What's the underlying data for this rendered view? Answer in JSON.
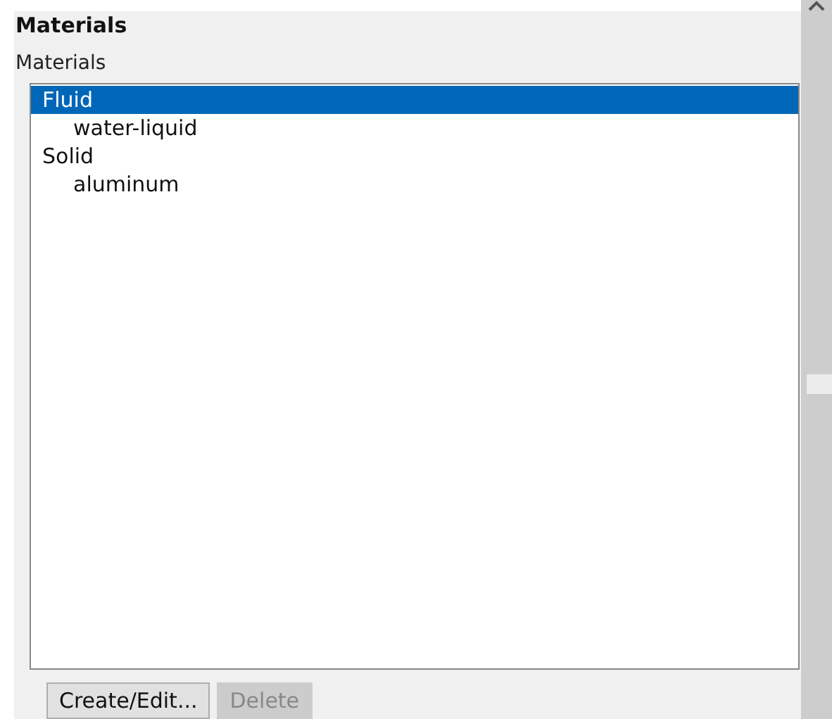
{
  "panel": {
    "title": "Materials"
  },
  "materials": {
    "label": "Materials",
    "tree": [
      {
        "label": "Fluid",
        "selected": true,
        "children": [
          {
            "label": "water-liquid",
            "selected": false
          }
        ]
      },
      {
        "label": "Solid",
        "selected": false,
        "children": [
          {
            "label": "aluminum",
            "selected": false
          }
        ]
      }
    ]
  },
  "buttons": [
    {
      "label": "Create/Edit...",
      "disabled": false
    },
    {
      "label": "Delete",
      "disabled": true
    }
  ]
}
